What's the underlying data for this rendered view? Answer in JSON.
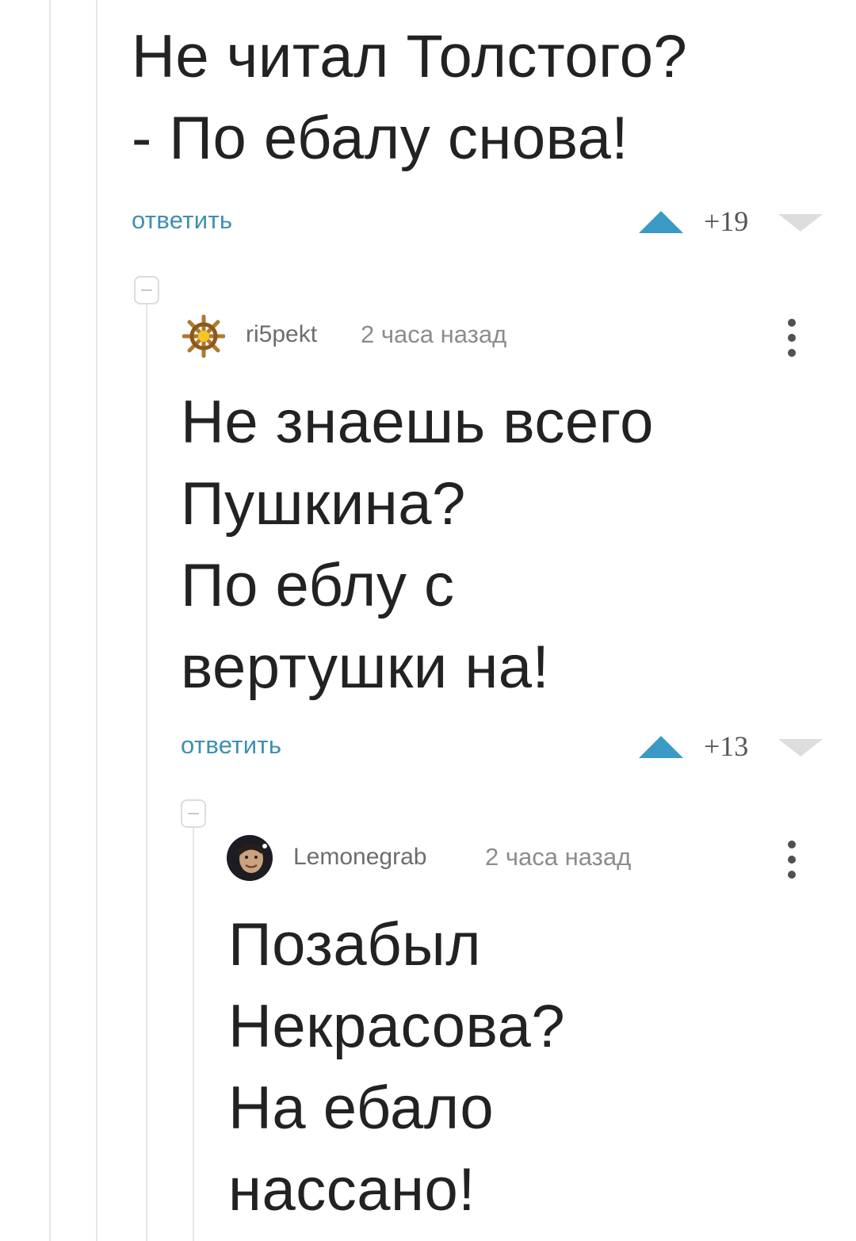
{
  "comments": [
    {
      "text": "Не читал Толстого?\n- По ебалу снова!",
      "reply_label": "ответить",
      "score": "+19"
    },
    {
      "author": "ri5pekt",
      "time": "2 часа назад",
      "avatar_icon": "ship-wheel-icon",
      "text": "Не знаешь всего\nПушкина?\nПо еблу с\nвертушки на!",
      "reply_label": "ответить",
      "score": "+13"
    },
    {
      "author": "Lemonegrab",
      "time": "2 часа назад",
      "avatar_icon": "user-photo-avatar",
      "text": "Позабыл\nНекрасова?\nНа ебало\nнассано!"
    }
  ],
  "colors": {
    "reply_link": "#3e8fb0",
    "vote_up": "#3a9ac5",
    "vote_down": "#dddddd",
    "thread_line": "#e6e6e6"
  }
}
